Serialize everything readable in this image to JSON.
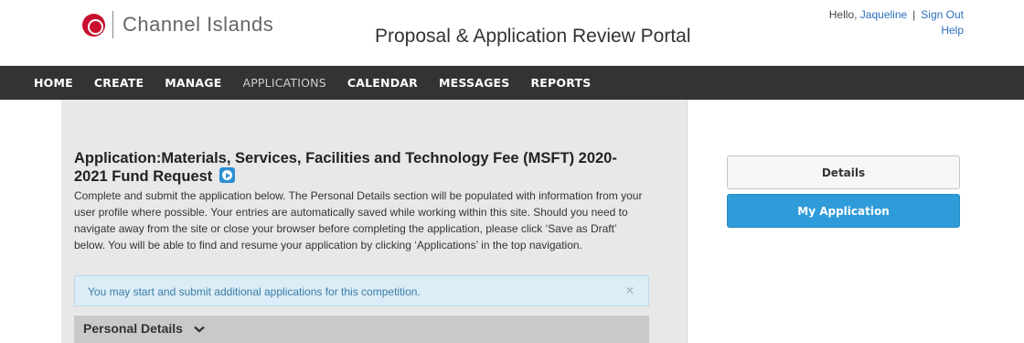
{
  "header": {
    "logo_text": "Channel Islands",
    "portal_title": "Proposal & Application Review Portal",
    "greeting": "Hello,",
    "user_name": "Jaqueline",
    "separator": "|",
    "sign_out": "Sign Out",
    "help": "Help"
  },
  "nav": {
    "items": [
      "HOME",
      "CREATE",
      "MANAGE",
      "APPLICATIONS",
      "CALENDAR",
      "MESSAGES",
      "REPORTS"
    ],
    "active": "APPLICATIONS"
  },
  "main": {
    "title": "Application:Materials, Services, Facilities and Technology Fee (MSFT) 2020-2021 Fund Request",
    "intro": "Complete and submit the application below. The Personal Details section will be populated with information from your user profile where possible. Your entries are automatically saved while working within this site. Should you need to navigate away from the site or close your browser before completing the application, please click ‘Save as Draft’ below. You will be able to find and resume your application by clicking ‘Applications’ in the top navigation.",
    "alert": "You may start and submit additional applications for this competition.",
    "alert_close": "×",
    "section_title": "Personal Details"
  },
  "side": {
    "details_label": "Details",
    "my_application_label": "My Application"
  },
  "colors": {
    "nav_bg": "#333333",
    "brand_red": "#c8102e",
    "primary_button": "#2f9bd8",
    "link": "#2a6ebb",
    "alert_bg": "#dcedf7"
  },
  "icons": {
    "logo": "csuci-seal-icon",
    "video": "play-video-icon",
    "close": "close-icon",
    "chevron": "chevron-down-icon"
  }
}
